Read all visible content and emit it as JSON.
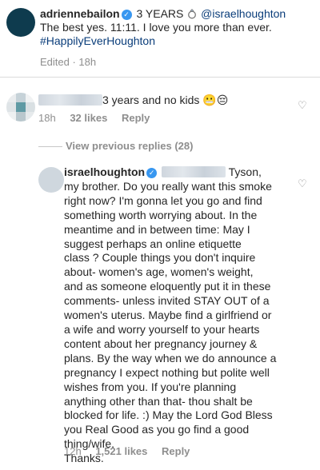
{
  "post": {
    "username": "adriennebailon",
    "caption_prefix": "3 YEARS",
    "ring_icon": "ring-icon",
    "mention": "@israelhoughton",
    "caption_line2": "The best yes. 11:11. I love you more than ever.",
    "hashtag": "#HappilyEverHoughton",
    "edited": "Edited · 18h"
  },
  "comment1": {
    "text": "3 years and no kids",
    "emojis": [
      "😬",
      "😔"
    ],
    "time": "18h",
    "likes": "32 likes",
    "reply": "Reply"
  },
  "view_replies": "View previous replies (28)",
  "reply": {
    "username": "israelhoughton",
    "name_suffix": "Tyson,",
    "lines": [
      "my brother. Do you really want this smoke",
      "right now? I'm gonna let you go and find",
      "something worth worrying about. In the",
      "meantime and in between time: May I",
      "suggest perhaps an online etiquette",
      "class ? Couple things you don't inquire",
      "about- women's age, women's weight,",
      "and as someone eloquently put it in these",
      "comments- unless invited STAY OUT of a",
      "women's uterus. Maybe find a girlfriend or",
      "a wife and worry yourself to your hearts",
      "content about her pregnancy journey &",
      "plans. By the way when we do announce a",
      "pregnancy I expect nothing but polite well",
      "wishes from you. If you're planning",
      "anything other than that- thou shalt be",
      "blocked for life. :) May the Lord God Bless",
      "you Real Good as you go find a good",
      "thing/wife.",
      "Thanks."
    ],
    "time": "12h",
    "likes": "1,521 likes",
    "reply": "Reply"
  },
  "colors": {
    "verified": "#3897f0",
    "link": "#0a3d7a",
    "muted": "#8e8e8e"
  }
}
